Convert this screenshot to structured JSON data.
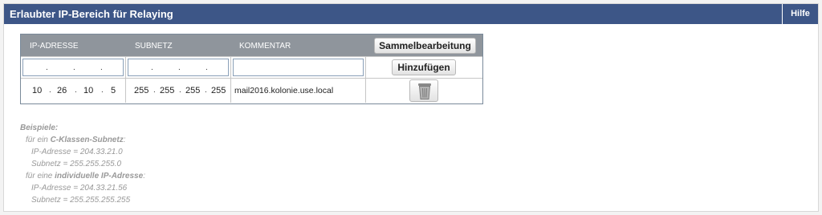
{
  "header": {
    "title": "Erlaubter IP-Bereich für Relaying",
    "help_label": "Hilfe"
  },
  "table": {
    "columns": [
      "IP-ADRESSE",
      "SUBNETZ",
      "KOMMENTAR"
    ],
    "bulk_edit_label": "Sammelbearbeitung",
    "new_row": {
      "add_label": "Hinzufügen",
      "ip": [
        "",
        "",
        "",
        ""
      ],
      "subnet": [
        "",
        "",
        "",
        ""
      ],
      "comment": ""
    },
    "rows": [
      {
        "ip": [
          "10",
          "26",
          "10",
          "5"
        ],
        "subnet": [
          "255",
          "255",
          "255",
          "255"
        ],
        "comment": "mail2016.kolonie.use.local"
      }
    ]
  },
  "examples": {
    "heading": "Beispiele:",
    "c_class_prefix": "für ein ",
    "c_class_label": "C-Klassen-Subnetz",
    "c_class_suffix": ":",
    "c_ip": "IP-Adresse = 204.33.21.0",
    "c_subnet": "Subnetz = 255.255.255.0",
    "indiv_prefix": "für eine ",
    "indiv_label": "individuelle IP-Adresse",
    "indiv_suffix": ":",
    "indiv_ip": "IP-Adresse = 204.33.21.56",
    "indiv_subnet": "Subnetz = 255.255.255.255"
  }
}
